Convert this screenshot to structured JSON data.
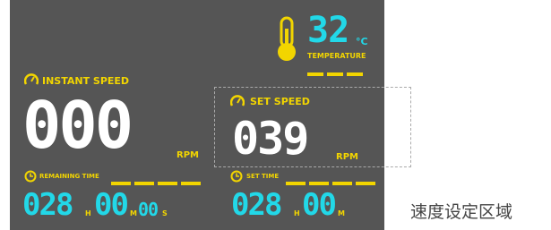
{
  "colors": {
    "panel": "#555555",
    "yellow": "#f2d500",
    "cyan": "#22d8e8",
    "white": "#ffffff"
  },
  "temperature": {
    "icon": "thermometer-icon",
    "value": "32",
    "unit": "°C",
    "label": "TEMPERATURE"
  },
  "instant_speed": {
    "icon": "speedometer-icon",
    "label": "INSTANT SPEED",
    "value": "000",
    "unit": "RPM"
  },
  "set_speed": {
    "icon": "speedometer-icon",
    "label": "SET SPEED",
    "value": "039",
    "unit": "RPM"
  },
  "remaining_time": {
    "icon": "clock-icon",
    "label": "REMAINING TIME",
    "hours": "028",
    "h_unit": "H",
    "minutes": "00",
    "m_unit": "M",
    "seconds": "00",
    "s_unit": "S"
  },
  "set_time": {
    "icon": "clock-icon",
    "label": "SET TIME",
    "hours": "028",
    "h_unit": "H",
    "minutes": "00",
    "m_unit": "M"
  },
  "annotation": {
    "text": "速度设定区域"
  }
}
